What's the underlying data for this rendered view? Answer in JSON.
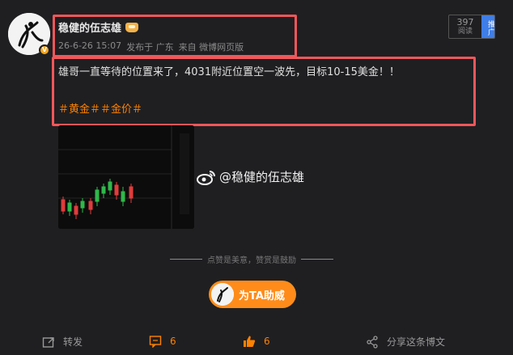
{
  "post": {
    "username": "稳健的伍志雄",
    "timestamp": "26-6-26 15:07",
    "published_at": "发布于 广东",
    "source": "来自 微博网页版",
    "text": "雄哥一直等待的位置来了，4031附近位置空一波先，目标10-15美金！！",
    "tags": "＃黄金＃＃金价＃",
    "views": {
      "count": "397",
      "label": "阅读",
      "promote": "推广"
    },
    "watermark": "@稳健的伍志雄",
    "slogan": "点赞是美意，赞赏是鼓励",
    "support_button": "为TA助威"
  },
  "actions": {
    "forward": "转发",
    "comments": "6",
    "likes": "6",
    "share": "分享这条博文"
  },
  "icons": {
    "forward": "forward-icon",
    "comment": "comment-icon",
    "like": "thumbs-up-icon",
    "share": "share-icon",
    "weibo": "weibo-logo-icon",
    "crown": "crown-icon",
    "verified": "verified-badge-icon"
  },
  "colors": {
    "background": "#1f1f22",
    "accent": "#ff8200",
    "highlight": "#f0575a",
    "support": "#ff8c1a",
    "candle_up": "#2fb84a",
    "candle_down": "#e03c3c"
  }
}
